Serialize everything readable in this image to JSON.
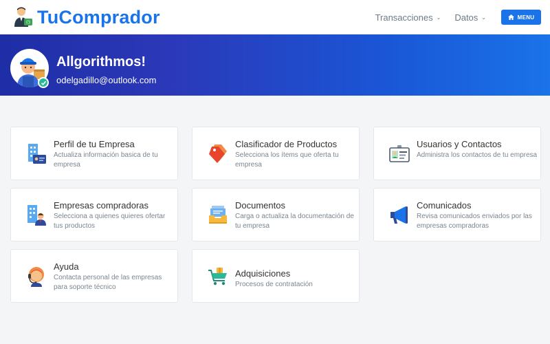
{
  "brand": {
    "name": "TuComprador"
  },
  "nav": {
    "transacciones": "Transacciones",
    "datos": "Datos",
    "menu": "MENU"
  },
  "user": {
    "greeting": "Allgorithmos!",
    "email": "odelgadillo@outlook.com"
  },
  "cards": [
    {
      "title": "Perfil de tu Empresa",
      "desc": "Actualiza información basica de tu empresa",
      "icon": "building-id-icon"
    },
    {
      "title": "Clasificador de Productos",
      "desc": "Selecciona los ítems que oferta tu empresa",
      "icon": "tags-icon"
    },
    {
      "title": "Usuarios y Contactos",
      "desc": "Administra los contactos de tu empresa",
      "icon": "id-card-icon"
    },
    {
      "title": "Empresas compradoras",
      "desc": "Selecciona a quienes quieres ofertar tus productos",
      "icon": "building-person-icon"
    },
    {
      "title": "Documentos",
      "desc": "Carga o actualiza la documentación de tu empresa",
      "icon": "documents-tray-icon"
    },
    {
      "title": "Comunicados",
      "desc": "Revisa comunicados enviados por las empresas compradoras",
      "icon": "megaphone-icon"
    },
    {
      "title": "Ayuda",
      "desc": "Contacta personal de las empresas para soporte técnico",
      "icon": "support-agent-icon"
    },
    {
      "title": "Adquisiciones",
      "desc": "Procesos de contratación",
      "icon": "shopping-cart-icon"
    }
  ],
  "colors": {
    "primary": "#1a73e8",
    "hero_start": "#1e2ea6",
    "hero_end": "#1a73e8"
  }
}
